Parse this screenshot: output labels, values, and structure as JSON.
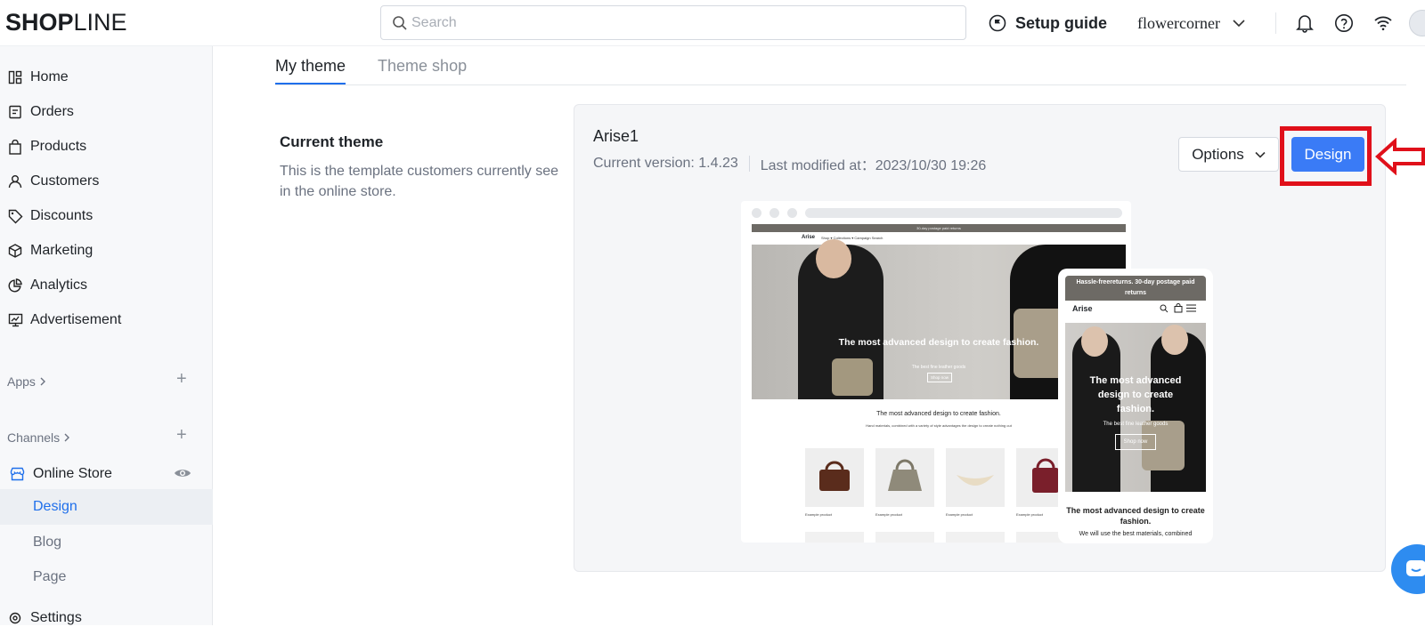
{
  "header": {
    "logo_bold": "SHOP",
    "logo_thin": "LINE",
    "search_placeholder": "Search",
    "setup_guide": "Setup guide",
    "store_name": "flowercorner"
  },
  "sidebar": {
    "items": [
      {
        "label": "Home",
        "icon": "dashboard-icon"
      },
      {
        "label": "Orders",
        "icon": "orders-icon"
      },
      {
        "label": "Products",
        "icon": "bag-icon"
      },
      {
        "label": "Customers",
        "icon": "person-icon"
      },
      {
        "label": "Discounts",
        "icon": "tag-icon"
      },
      {
        "label": "Marketing",
        "icon": "cube-icon"
      },
      {
        "label": "Analytics",
        "icon": "pie-chart-icon"
      },
      {
        "label": "Advertisement",
        "icon": "monitor-icon"
      }
    ],
    "apps_label": "Apps",
    "channels_label": "Channels",
    "online_store": "Online Store",
    "sub_items": [
      "Design",
      "Blog",
      "Page"
    ],
    "settings_label": "Settings"
  },
  "main": {
    "tabs": [
      "My theme",
      "Theme shop"
    ],
    "current_theme_title": "Current theme",
    "current_theme_desc": "This is the template customers currently see in the online store.",
    "theme_name": "Arise1",
    "current_version": "Current version: 1.4.23",
    "last_modified": "Last modified at：2023/10/30 19:26",
    "options_label": "Options",
    "design_label": "Design"
  },
  "preview": {
    "desktop_banner": "30-day postage paid returns",
    "brand": "Arise",
    "nav_links": "Shop ▾    Collections ▾    Campaign    Search",
    "hero_title": "The most advanced design to create fashion.",
    "hero_sub": "The best fine leather goods",
    "shop_now": "Shop now",
    "section_title": "The most advanced design to create fashion.",
    "section_sub": "Hand materials, combined with a variety of style advantages the design to create nothing out",
    "product_caption": "Example product",
    "mobile_banner": "Hassle-freereturns. 30-day postage paid returns",
    "mobile_hero_title": "The most advanced design to create fashion.",
    "mobile_hero_sub": "The best fine leather goods",
    "mobile_section_title": "The most advanced design to create fashion.",
    "mobile_section_sub": "We will use the best materials, combined"
  },
  "colors": {
    "accent": "#1f6feb",
    "design_button": "#3a7bf6",
    "highlight": "#e0101a"
  }
}
